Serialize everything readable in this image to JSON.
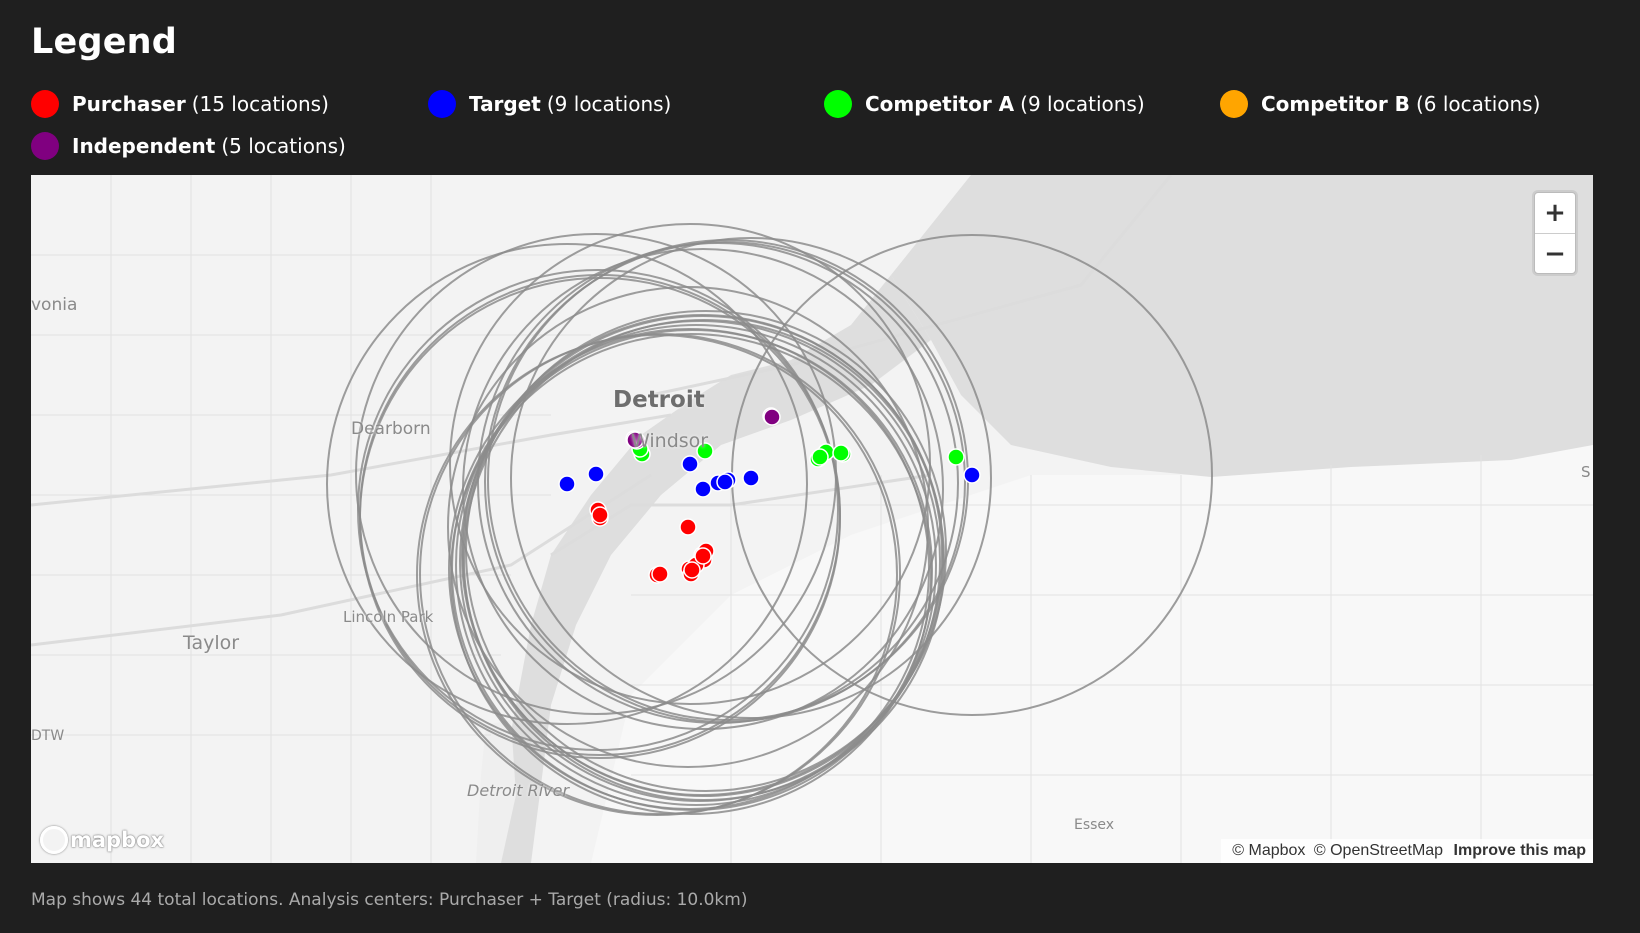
{
  "legend": {
    "title": "Legend",
    "items": [
      {
        "name": "Purchaser",
        "count": "(15 locations)",
        "color": "#ff0000"
      },
      {
        "name": "Target",
        "count": "(9 locations)",
        "color": "#0000ff"
      },
      {
        "name": "Competitor A",
        "count": "(9 locations)",
        "color": "#00ff00"
      },
      {
        "name": "Competitor B",
        "count": "(6 locations)",
        "color": "#ffa500"
      },
      {
        "name": "Independent",
        "count": "(5 locations)",
        "color": "#800080"
      }
    ]
  },
  "map": {
    "places": {
      "detroit": "Detroit",
      "windsor": "Windsor",
      "dearborn": "Dearborn",
      "livonia": "vonia",
      "taylor": "Taylor",
      "lincoln_park": "Lincoln Park",
      "dtw": "DTW",
      "detroit_river": "Detroit River",
      "essex": "Essex",
      "edge_s": "S"
    },
    "zoom_in": "+",
    "zoom_out": "−",
    "logo": "mapbox",
    "attribution": {
      "mapbox": "© Mapbox",
      "osm": "© OpenStreetMap",
      "improve": "Improve this map"
    },
    "water_color": "#dedede",
    "land_color": "#f3f3f3",
    "circle_color": "#8c8c8c"
  },
  "footer": "Map shows 44 total locations. Analysis centers: Purchaser + Target (radius: 10.0km)"
}
